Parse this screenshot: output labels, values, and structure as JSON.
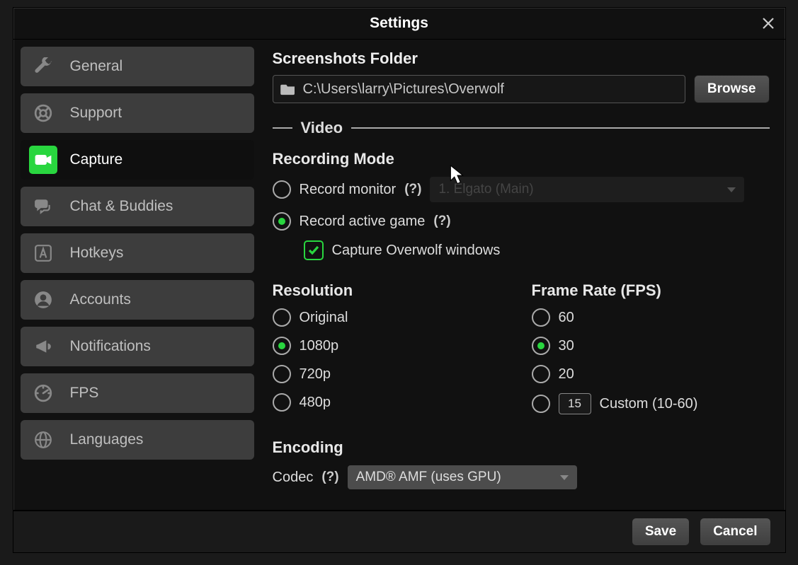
{
  "title": "Settings",
  "sidebar": {
    "items": [
      {
        "label": "General",
        "icon": "wrench"
      },
      {
        "label": "Support",
        "icon": "lifebuoy"
      },
      {
        "label": "Capture",
        "icon": "camera"
      },
      {
        "label": "Chat & Buddies",
        "icon": "chat"
      },
      {
        "label": "Hotkeys",
        "icon": "letter-a"
      },
      {
        "label": "Accounts",
        "icon": "user"
      },
      {
        "label": "Notifications",
        "icon": "megaphone"
      },
      {
        "label": "FPS",
        "icon": "gauge"
      },
      {
        "label": "Languages",
        "icon": "globe"
      }
    ],
    "active_index": 2
  },
  "screenshots": {
    "heading": "Screenshots Folder",
    "path": "C:\\Users\\larry\\Pictures\\Overwolf",
    "browse_label": "Browse"
  },
  "video": {
    "divider_label": "Video",
    "recording_heading": "Recording Mode",
    "record_monitor_label": "Record monitor",
    "record_monitor_help": "(?)",
    "monitor_select_value": "1. Elgato (Main)",
    "record_game_label": "Record active game",
    "record_game_help": "(?)",
    "capture_overwolf_label": "Capture Overwolf windows",
    "capture_overwolf_checked": true,
    "recording_selected": "game"
  },
  "resolution": {
    "heading": "Resolution",
    "options": [
      "Original",
      "1080p",
      "720p",
      "480p"
    ],
    "selected_index": 1
  },
  "fps": {
    "heading": "Frame Rate (FPS)",
    "opt60": "60",
    "opt30": "30",
    "opt20": "20",
    "custom_value": "15",
    "custom_label": "Custom (10-60)",
    "selected": "30"
  },
  "encoding": {
    "heading": "Encoding",
    "codec_label": "Codec",
    "codec_help": "(?)",
    "codec_value": "AMD® AMF (uses GPU)"
  },
  "footer": {
    "save": "Save",
    "cancel": "Cancel"
  }
}
